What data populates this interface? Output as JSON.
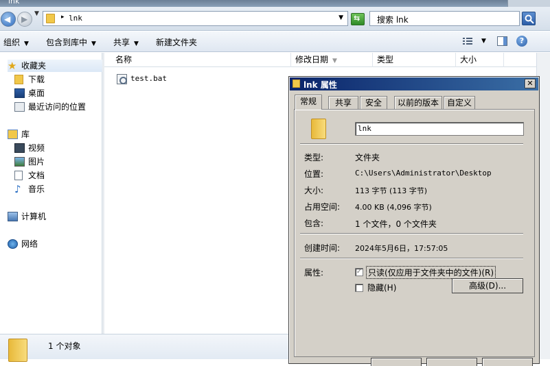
{
  "window": {
    "title": "lnk"
  },
  "address": {
    "path": "lnk",
    "search_placeholder": "搜索 lnk"
  },
  "toolbar": {
    "organize": "组织",
    "include_library": "包含到库中",
    "share": "共享",
    "new_folder": "新建文件夹"
  },
  "nav": {
    "favorites": "收藏夹",
    "downloads": "下载",
    "desktop": "桌面",
    "recent": "最近访问的位置",
    "libraries": "库",
    "videos": "视频",
    "pictures": "图片",
    "documents": "文档",
    "music": "音乐",
    "computer": "计算机",
    "network": "网络"
  },
  "columns": {
    "name": "名称",
    "date": "修改日期",
    "type": "类型",
    "size": "大小"
  },
  "files": [
    {
      "name": "test.bat"
    }
  ],
  "status": {
    "count": "1 个对象"
  },
  "dialog": {
    "title": "lnk 属性",
    "tabs": [
      "常规",
      "共享",
      "安全",
      "以前的版本",
      "自定义"
    ],
    "name": "lnk",
    "rows": {
      "type_label": "类型:",
      "type_value": "文件夹",
      "location_label": "位置:",
      "location_value": "C:\\Users\\Administrator\\Desktop",
      "size_label": "大小:",
      "size_value": "113 字节 (113 字节)",
      "disk_label": "占用空间:",
      "disk_value": "4.00 KB (4,096 字节)",
      "contains_label": "包含:",
      "contains_value": "1 个文件，0 个文件夹",
      "created_label": "创建时间:",
      "created_value": "2024年5月6日，17:57:05",
      "attributes_label": "属性:"
    },
    "readonly_label": "只读(仅应用于文件夹中的文件)(R)",
    "readonly_checked": true,
    "hidden_label": "隐藏(H)",
    "advanced_label": "高级(D)..."
  },
  "colors": {
    "accent": "#0a246a",
    "folder": "#f1c84a"
  }
}
